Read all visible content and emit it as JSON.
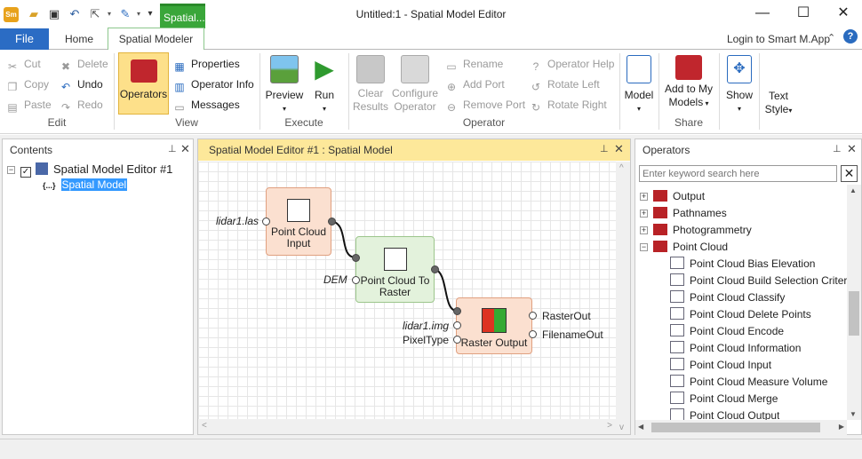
{
  "window": {
    "title": "Untitled:1 - Spatial Model Editor",
    "context_tab": "Spatial..."
  },
  "tabs": {
    "file": "File",
    "home": "Home",
    "spatial_modeler": "Spatial Modeler"
  },
  "login": "Login to Smart M.App",
  "ribbon": {
    "edit": {
      "label": "Edit",
      "cut": "Cut",
      "copy": "Copy",
      "paste": "Paste",
      "delete": "Delete",
      "undo": "Undo",
      "redo": "Redo"
    },
    "view": {
      "label": "View",
      "operators": "Operators",
      "properties": "Properties",
      "operator_info": "Operator Info",
      "messages": "Messages"
    },
    "execute": {
      "label": "Execute",
      "preview": "Preview",
      "run": "Run"
    },
    "operator": {
      "label": "Operator",
      "clear1": "Clear",
      "clear2": "Results",
      "configure1": "Configure",
      "configure2": "Operator",
      "rename": "Rename",
      "add_port": "Add Port",
      "remove_port": "Remove Port",
      "operator_help": "Operator Help",
      "rotate_left": "Rotate Left",
      "rotate_right": "Rotate Right"
    },
    "model": {
      "label": "Model"
    },
    "share": {
      "label": "Share",
      "add1": "Add to My",
      "add2": "Models"
    },
    "show": {
      "label": "Show"
    },
    "text_style": {
      "line1": "Text",
      "line2": "Style"
    }
  },
  "contents": {
    "title": "Contents",
    "root": "Spatial Model Editor #1",
    "child": "Spatial Model"
  },
  "editor": {
    "title": "Spatial Model Editor #1 : Spatial Model",
    "nodes": {
      "pci": {
        "line1": "Point Cloud",
        "line2": "Input",
        "input_label": "lidar1.las"
      },
      "pctr": {
        "line1": "Point Cloud To",
        "line2": "Raster",
        "input_label": "DEM"
      },
      "ro": {
        "line1": "Raster Output",
        "input1": "lidar1.img",
        "input2": "PixelType",
        "out1": "RasterOut",
        "out2": "FilenameOut"
      }
    }
  },
  "operators": {
    "title": "Operators",
    "search_placeholder": "Enter keyword search here",
    "categories": [
      "Output",
      "Pathnames",
      "Photogrammetry",
      "Point Cloud"
    ],
    "items": [
      "Point Cloud Bias Elevation",
      "Point Cloud Build Selection Criteri",
      "Point Cloud Classify",
      "Point Cloud Delete Points",
      "Point Cloud Encode",
      "Point Cloud Information",
      "Point Cloud Input",
      "Point Cloud Measure Volume",
      "Point Cloud Merge",
      "Point Cloud Output"
    ]
  }
}
